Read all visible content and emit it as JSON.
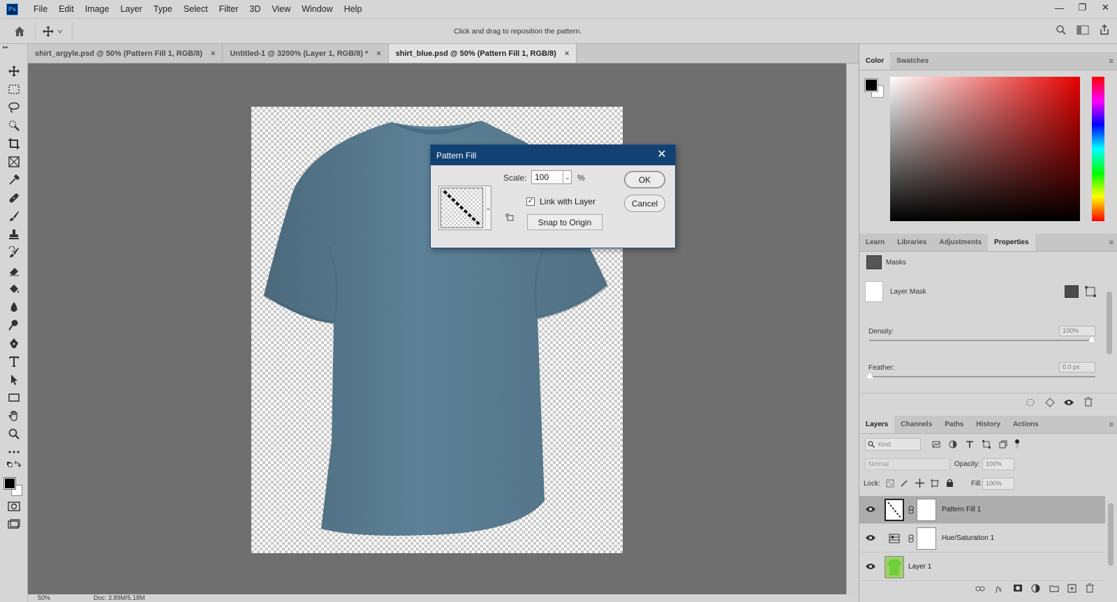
{
  "app": {
    "logo": "Ps"
  },
  "menu": [
    "File",
    "Edit",
    "Image",
    "Layer",
    "Type",
    "Select",
    "Filter",
    "3D",
    "View",
    "Window",
    "Help"
  ],
  "window_controls": {
    "minimize": "—",
    "restore": "❐",
    "close": "✕"
  },
  "options_bar": {
    "hint": "Click and drag to reposition the pattern."
  },
  "tabs": [
    {
      "label": "shirt_argyle.psd @ 50% (Pattern Fill 1, RGB/8)",
      "close": "×",
      "active": false
    },
    {
      "label": "Untitled-1 @ 3200% (Layer 1, RGB/8) *",
      "close": "×",
      "active": false
    },
    {
      "label": "shirt_blue.psd @ 50% (Pattern Fill 1, RGB/8)",
      "close": "×",
      "active": true
    }
  ],
  "status_bar": {
    "zoom": "50%",
    "doc": "Doc: 3.89M/5.18M"
  },
  "dialog": {
    "title": "Pattern Fill",
    "close": "✕",
    "scale_label": "Scale:",
    "scale_value": "100",
    "scale_unit": "%",
    "link_with_layer_label": "Link with Layer",
    "link_with_layer_checked": true,
    "snap_to_origin_label": "Snap to Origin",
    "ok_label": "OK",
    "cancel_label": "Cancel"
  },
  "color_panel": {
    "tabs": [
      "Color",
      "Swatches"
    ],
    "foreground": "#000000",
    "background": "#ffffff",
    "hue_color": "#e60000"
  },
  "properties_panel": {
    "tabs": [
      "Learn",
      "Libraries",
      "Adjustments",
      "Properties"
    ],
    "section_label": "Masks",
    "mask_label": "Layer Mask",
    "density_label": "Density:",
    "density_value": "100%",
    "feather_label": "Feather:",
    "feather_value": "0.0 px"
  },
  "layers_panel": {
    "tabs": [
      "Layers",
      "Channels",
      "Paths",
      "History",
      "Actions"
    ],
    "filter_placeholder": "Kind",
    "blend_mode": "Normal",
    "opacity_label": "Opacity:",
    "opacity_value": "100%",
    "lock_label": "Lock:",
    "fill_label": "Fill:",
    "fill_value": "100%",
    "layers": [
      {
        "name": "Pattern Fill 1",
        "selected": true
      },
      {
        "name": "Hue/Saturation 1",
        "selected": false
      },
      {
        "name": "Layer 1",
        "selected": false
      }
    ]
  },
  "colors": {
    "shirt": "#5f8399",
    "dialog_title_bar": "#124273",
    "canvas_bg": "#6f6f6f"
  }
}
